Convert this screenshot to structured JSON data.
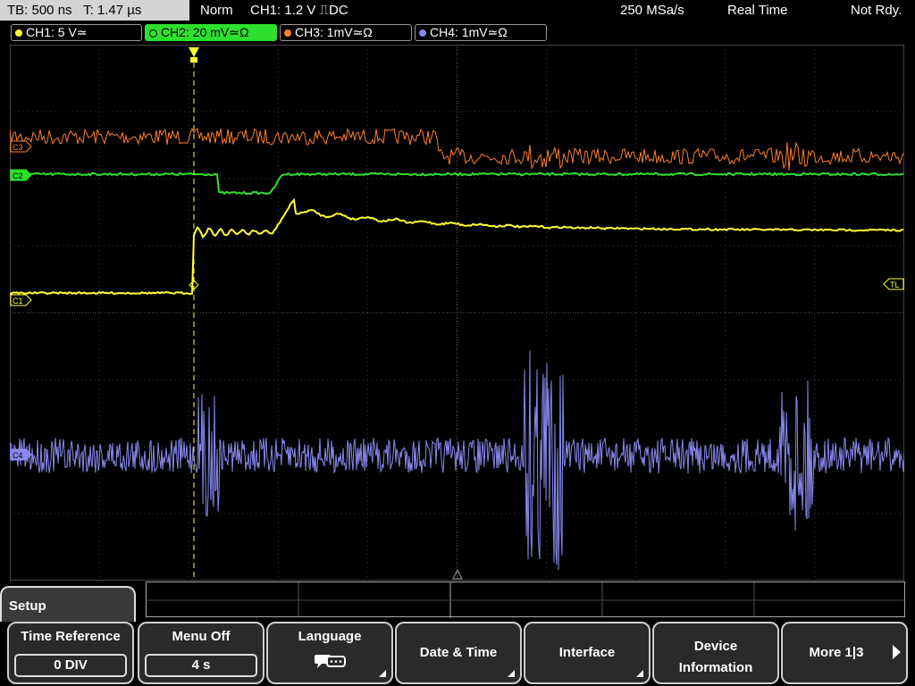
{
  "status": {
    "timebase": "TB: 500 ns",
    "trigger_time": "T: 1.47 µs",
    "trigger_mode": "Norm",
    "trigger_setting": "CH1: 1.2 V ⎍DC",
    "sample_rate": "250 MSa/s",
    "acq_mode": "Real Time",
    "ready_state": "Not Rdy."
  },
  "channels": [
    {
      "label": "CH1: 5 V≃",
      "color": "#ffff33",
      "active": false
    },
    {
      "label": "CH2: 20 mV≃Ω",
      "color": "#2ee02e",
      "active": true
    },
    {
      "label": "CH3: 1mV≃Ω",
      "color": "#ff7f27",
      "active": false
    },
    {
      "label": "CH4: 1mV≃Ω",
      "color": "#8888ee",
      "active": false
    }
  ],
  "markers": {
    "c3": "C3",
    "c2": "C2",
    "c1": "C1",
    "c4": "C4",
    "tl": "TL"
  },
  "menu": {
    "title": "Setup",
    "time_reference": {
      "label": "Time Reference",
      "value": "0 DIV"
    },
    "menu_off": {
      "label": "Menu Off",
      "value": "4 s"
    },
    "language": {
      "label": "Language",
      "icon": "speech-bubbles-icon"
    },
    "date_time": {
      "label": "Date & Time"
    },
    "interface": {
      "label": "Interface"
    },
    "device_info": {
      "label1": "Device",
      "label2": "Information"
    },
    "more": {
      "label": "More 1|3"
    }
  }
}
